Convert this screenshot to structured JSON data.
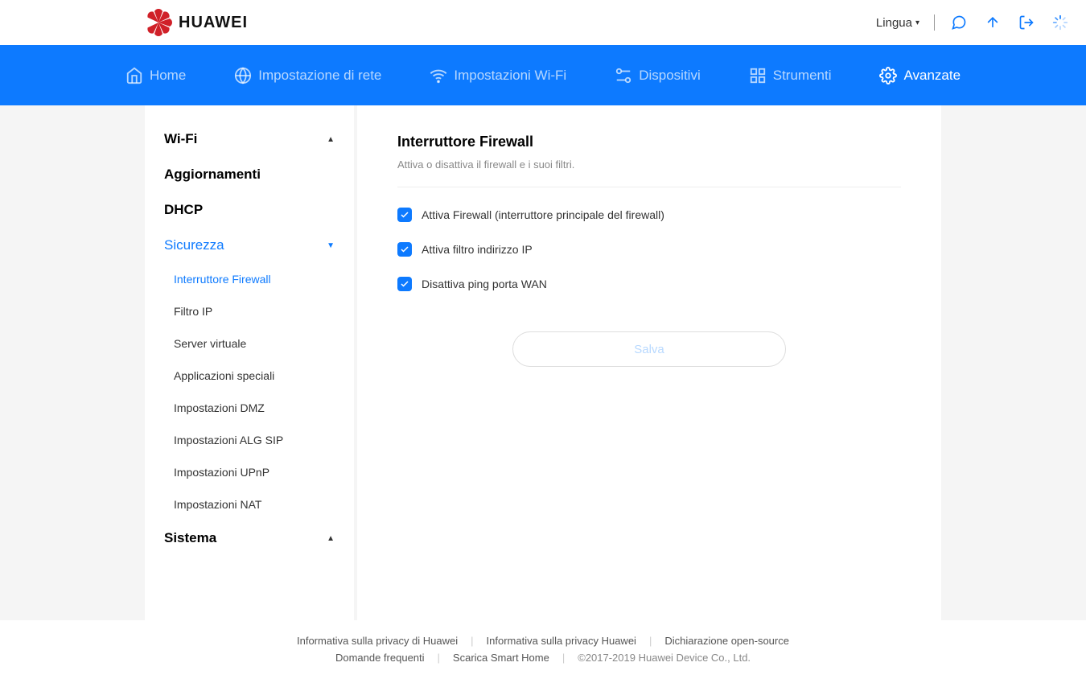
{
  "header": {
    "brand": "HUAWEI",
    "language_label": "Lingua"
  },
  "nav": {
    "home": "Home",
    "network": "Impostazione di rete",
    "wifi": "Impostazioni Wi-Fi",
    "devices": "Dispositivi",
    "tools": "Strumenti",
    "advanced": "Avanzate"
  },
  "sidebar": {
    "items": [
      {
        "label": "Wi-Fi",
        "expanded": true,
        "active": false,
        "sub": []
      },
      {
        "label": "Aggiornamenti",
        "expanded": false,
        "active": false,
        "sub": []
      },
      {
        "label": "DHCP",
        "expanded": false,
        "active": false,
        "sub": []
      },
      {
        "label": "Sicurezza",
        "expanded": true,
        "active": true,
        "sub": [
          {
            "label": "Interruttore Firewall",
            "active": true
          },
          {
            "label": "Filtro IP",
            "active": false
          },
          {
            "label": "Server virtuale",
            "active": false
          },
          {
            "label": "Applicazioni speciali",
            "active": false
          },
          {
            "label": "Impostazioni DMZ",
            "active": false
          },
          {
            "label": "Impostazioni ALG SIP",
            "active": false
          },
          {
            "label": "Impostazioni UPnP",
            "active": false
          },
          {
            "label": "Impostazioni NAT",
            "active": false
          }
        ]
      },
      {
        "label": "Sistema",
        "expanded": true,
        "active": false,
        "sub": []
      }
    ]
  },
  "panel": {
    "title": "Interruttore Firewall",
    "description": "Attiva o disattiva il firewall e i suoi filtri.",
    "checkboxes": [
      {
        "label": "Attiva Firewall (interruttore principale del firewall)",
        "checked": true
      },
      {
        "label": "Attiva filtro indirizzo IP",
        "checked": true
      },
      {
        "label": "Disattiva ping porta WAN",
        "checked": true
      }
    ],
    "save_label": "Salva"
  },
  "footer": {
    "links": [
      "Informativa sulla privacy di Huawei",
      "Informativa sulla privacy Huawei",
      "Dichiarazione open-source",
      "Domande frequenti",
      "Scarica Smart Home"
    ],
    "copyright": "©2017-2019 Huawei Device Co., Ltd."
  }
}
